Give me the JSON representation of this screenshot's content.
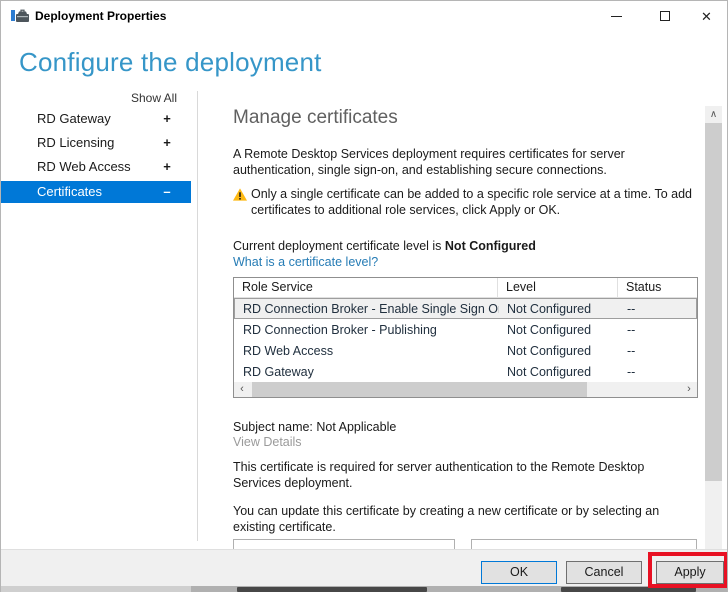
{
  "window": {
    "title": "Deployment Properties",
    "close_glyph": "✕"
  },
  "page": {
    "heading": "Configure the deployment"
  },
  "sidebar": {
    "show_all": "Show All",
    "items": [
      {
        "label": "RD Gateway",
        "expander": "+"
      },
      {
        "label": "RD Licensing",
        "expander": "+"
      },
      {
        "label": "RD Web Access",
        "expander": "+"
      },
      {
        "label": "Certificates",
        "expander": "–"
      }
    ]
  },
  "main": {
    "heading": "Manage certificates",
    "intro": "A Remote Desktop Services deployment requires certificates for server authentication, single sign-on, and establishing secure connections.",
    "warning": "Only a single certificate can be added to a specific role service at a time. To add certificates to additional role services, click Apply or OK.",
    "level_prefix": "Current deployment certificate level is ",
    "level_value": "Not Configured",
    "level_link": "What is a certificate level?",
    "table": {
      "columns": [
        "Role Service",
        "Level",
        "Status"
      ],
      "rows": [
        {
          "role_service": "RD Connection Broker - Enable Single Sign On",
          "level": "Not Configured",
          "status": "--"
        },
        {
          "role_service": "RD Connection Broker - Publishing",
          "level": "Not Configured",
          "status": "--"
        },
        {
          "role_service": "RD Web Access",
          "level": "Not Configured",
          "status": "--"
        },
        {
          "role_service": "RD Gateway",
          "level": "Not Configured",
          "status": "--"
        }
      ],
      "hscroll_left": "‹",
      "hscroll_right": "›"
    },
    "subject_name": "Subject name: Not Applicable",
    "view_details": "View Details",
    "para1": "This certificate is required for server authentication to the Remote Desktop Services deployment.",
    "para2": "You can update this certificate by creating a new certificate or by selecting an existing certificate.",
    "vscroll_up": "∧",
    "vscroll_down": "∨"
  },
  "footer": {
    "ok": "OK",
    "cancel": "Cancel",
    "apply": "Apply"
  },
  "colors": {
    "heading_blue": "#3696c8",
    "selected_item_blue": "#0078d7",
    "link_blue": "#267cb5",
    "warning_yellow": "#fdb913",
    "annotation_red": "#e81123",
    "ok_border_blue": "#0078d7",
    "footer_gray": "#f0f0f0"
  }
}
